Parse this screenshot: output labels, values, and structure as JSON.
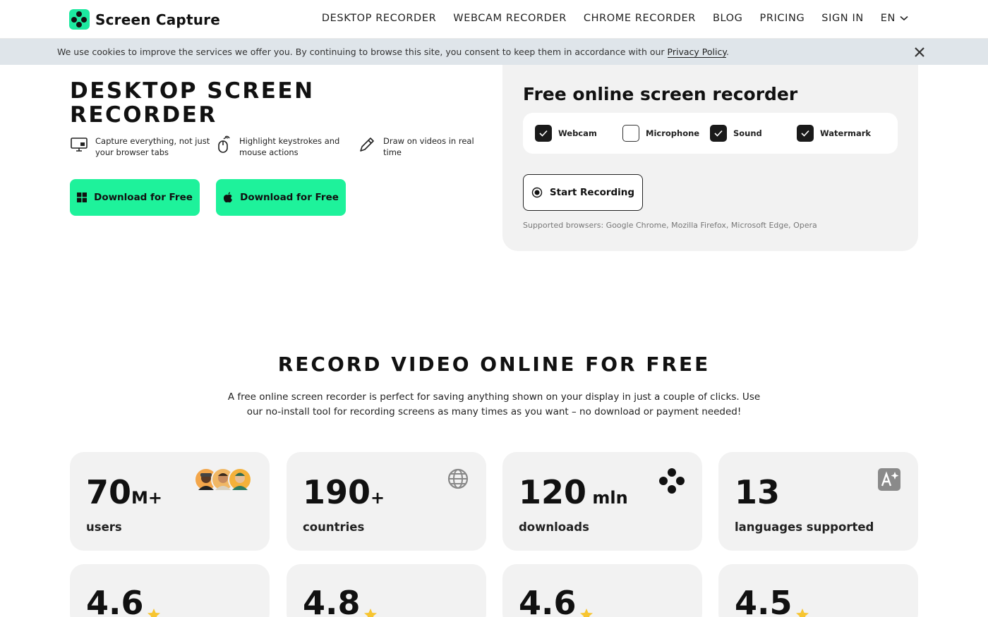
{
  "header": {
    "brand": "Screen Capture",
    "nav": [
      {
        "label": "DESKTOP RECORDER"
      },
      {
        "label": "WEBCAM RECORDER"
      },
      {
        "label": "CHROME RECORDER"
      },
      {
        "label": "BLOG"
      },
      {
        "label": "PRICING"
      },
      {
        "label": "SIGN IN"
      }
    ],
    "language": "EN"
  },
  "cookie": {
    "text": "We use cookies to improve the services we offer you. By continuing to browse this site, you consent to keep them in accordance with our ",
    "link": "Privacy Policy",
    "end": "."
  },
  "hero": {
    "title": "DESKTOP SCREEN RECORDER",
    "features": [
      {
        "text": "Capture everything, not just your browser tabs",
        "icon": "monitor-icon"
      },
      {
        "text": "Highlight keystrokes and mouse actions",
        "icon": "mouse-icon"
      },
      {
        "text": "Draw on videos in real time",
        "icon": "pencil-icon"
      }
    ],
    "download_windows": "Download for Free",
    "download_mac": "Download for Free"
  },
  "recorder": {
    "title": "Free online screen recorder",
    "options": [
      {
        "label": "Webcam",
        "checked": true
      },
      {
        "label": "Microphone",
        "checked": false
      },
      {
        "label": "Sound",
        "checked": true
      },
      {
        "label": "Watermark",
        "checked": true
      }
    ],
    "start_label": "Start Recording",
    "supported": "Supported browsers: Google Chrome, Mozilla Firefox, Microsoft Edge, Opera"
  },
  "section": {
    "title": "RECORD VIDEO ONLINE FOR FREE",
    "text": "A free online screen recorder is perfect for saving anything shown on your display in just a couple of clicks. Use our no-install tool for recording screens as many times as you want – no download or payment needed!"
  },
  "stats": [
    {
      "value": "70",
      "suffix": "M+",
      "label": "users",
      "icon": "avatars"
    },
    {
      "value": "190",
      "suffix": "+",
      "label": "countries",
      "icon": "globe-icon"
    },
    {
      "value": "120",
      "suffix": " mln",
      "label": "downloads",
      "icon": "logo-dots-icon"
    },
    {
      "value": "13",
      "suffix": "",
      "label": "languages supported",
      "icon": "translate-icon"
    }
  ],
  "ratings": [
    {
      "value": "4.6"
    },
    {
      "value": "4.8"
    },
    {
      "value": "4.6"
    },
    {
      "value": "4.5"
    }
  ],
  "colors": {
    "accent": "#1ef29b",
    "cookie_bg": "#dfe5ea",
    "card_bg": "#f2f2f2",
    "star": "#f7c531"
  }
}
